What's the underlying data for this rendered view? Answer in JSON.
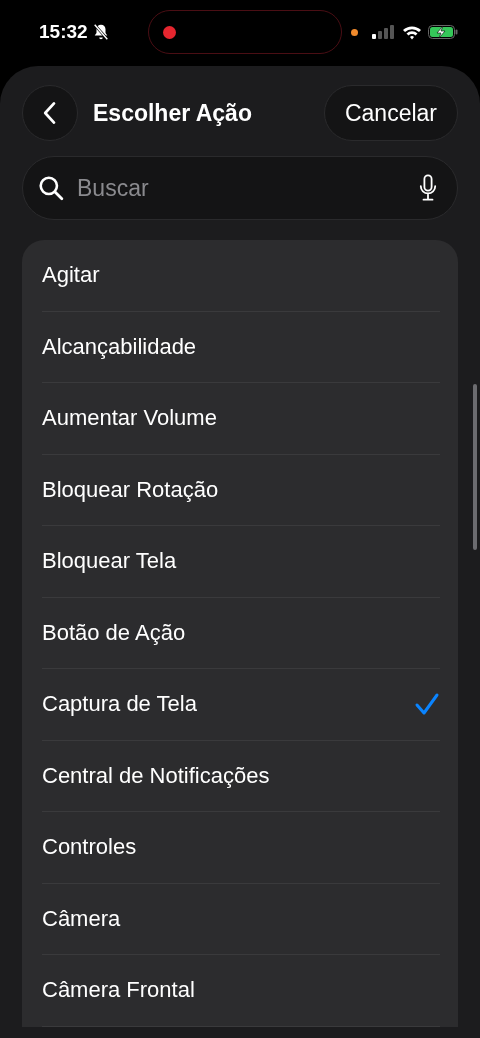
{
  "status_bar": {
    "time": "15:32",
    "silent": true,
    "recording": true
  },
  "header": {
    "title": "Escolher Ação",
    "cancel": "Cancelar"
  },
  "search": {
    "placeholder": "Buscar"
  },
  "actions": [
    {
      "label": "Agitar",
      "selected": false
    },
    {
      "label": "Alcançabilidade",
      "selected": false
    },
    {
      "label": "Aumentar Volume",
      "selected": false
    },
    {
      "label": "Bloquear Rotação",
      "selected": false
    },
    {
      "label": "Bloquear Tela",
      "selected": false
    },
    {
      "label": "Botão de Ação",
      "selected": false
    },
    {
      "label": "Captura de Tela",
      "selected": true
    },
    {
      "label": "Central de Notificações",
      "selected": false
    },
    {
      "label": "Controles",
      "selected": false
    },
    {
      "label": "Câmera",
      "selected": false
    },
    {
      "label": "Câmera Frontal",
      "selected": false
    }
  ]
}
